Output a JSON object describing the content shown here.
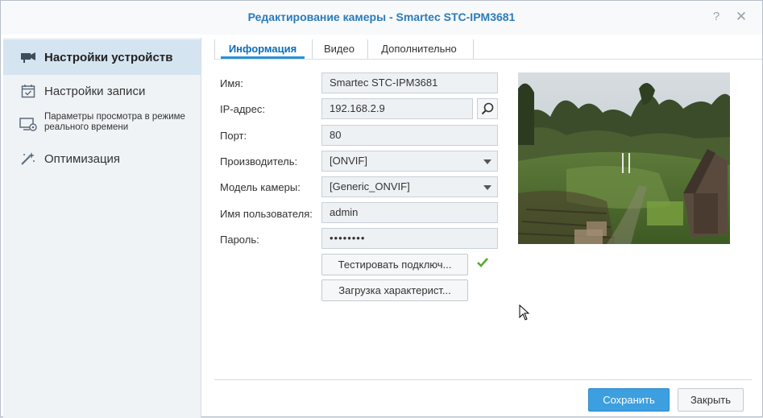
{
  "window": {
    "title": "Редактирование камеры - Smartec STC-IPM3681",
    "help_glyph": "?",
    "close_glyph": "✕"
  },
  "sidebar": {
    "items": [
      {
        "label": "Настройки устройств",
        "icon": "camera-icon",
        "active": true
      },
      {
        "label": "Настройки записи",
        "icon": "calendar-check-icon",
        "active": false
      },
      {
        "label": "Параметры просмотра в режиме реального времени",
        "icon": "monitor-camera-icon",
        "active": false
      },
      {
        "label": "Оптимизация",
        "icon": "magic-wand-icon",
        "active": false
      }
    ]
  },
  "tabs": [
    {
      "label": "Информация",
      "active": true
    },
    {
      "label": "Видео",
      "active": false
    },
    {
      "label": "Дополнительно",
      "active": false
    }
  ],
  "form": {
    "name": {
      "label": "Имя:",
      "value": "Smartec STC-IPM3681"
    },
    "ip": {
      "label": "IP-адрес:",
      "value": "192.168.2.9"
    },
    "port": {
      "label": "Порт:",
      "value": "80"
    },
    "manufacturer": {
      "label": "Производитель:",
      "value": "[ONVIF]"
    },
    "model": {
      "label": "Модель камеры:",
      "value": "[Generic_ONVIF]"
    },
    "username": {
      "label": "Имя пользователя:",
      "value": "admin"
    },
    "password": {
      "label": "Пароль:",
      "value": "••••••••"
    }
  },
  "actions": {
    "test_connection": "Тестировать подключ...",
    "load_capabilities": "Загрузка характерист...",
    "test_status": "success"
  },
  "footer": {
    "save": "Сохранить",
    "close": "Закрыть"
  },
  "colors": {
    "accent": "#3d9fe0",
    "title": "#2b7bb9",
    "success": "#5aa832"
  }
}
